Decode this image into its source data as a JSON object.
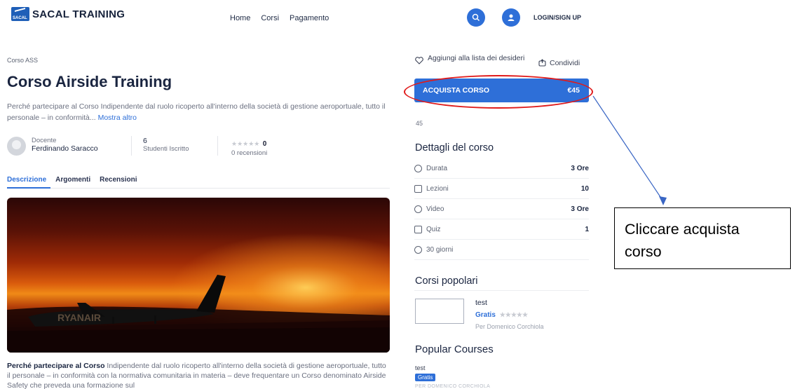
{
  "header": {
    "logo_text": "SACAL TRAINING",
    "logo_badge": "SACAL",
    "nav": [
      "Home",
      "Corsi",
      "Pagamento"
    ],
    "login": "LOGIN/SIGN UP",
    "search_icon": "search-icon",
    "user_icon": "user-icon"
  },
  "course": {
    "breadcrumb": "Corso ASS",
    "title": "Corso Airside Training",
    "intro": "Perché partecipare al Corso Indipendente dal ruolo ricoperto all'interno della società di gestione aeroportuale, tutto il personale – in conformità...",
    "more": "Mostra altro",
    "teacher_label": "Docente",
    "teacher_name": "Ferdinando Saracco",
    "students_count": "6",
    "students_label": "Studenti Iscritto",
    "rating_value": "0",
    "reviews_label": "0 recensioni",
    "tabs": [
      "Descrizione",
      "Argomenti",
      "Recensioni"
    ],
    "image_caption": "RYANAIR",
    "desc_bold": "Perché partecipare al Corso",
    "desc_text": " Indipendente dal ruolo ricoperto all'interno della società di gestione aeroportuale, tutto il personale – in conformità con la normativa comunitaria in materia – deve frequentare un Corso denominato Airside Safety che preveda una formazione sul"
  },
  "sidebar": {
    "wishlist": "Aggiungi alla lista dei desideri",
    "share": "Condividi",
    "buy_label": "ACQUISTA CORSO",
    "buy_price": "€45",
    "price_note": "45",
    "details_title": "Dettagli del corso",
    "details": [
      {
        "label": "Durata",
        "value": "3 Ore",
        "icon": "clock-icon"
      },
      {
        "label": "Lezioni",
        "value": "10",
        "icon": "book-icon"
      },
      {
        "label": "Video",
        "value": "3 Ore",
        "icon": "play-icon"
      },
      {
        "label": "Quiz",
        "value": "1",
        "icon": "quiz-icon"
      },
      {
        "label": "30 giorni",
        "value": "",
        "icon": "clock-icon"
      }
    ],
    "popular_title": "Corsi popolari",
    "popular_item_title": "test",
    "popular_item_price": "Gratis",
    "popular_item_by": "Per Domenico Corchiola",
    "popular_courses_title": "Popular Courses",
    "popular2_title": "test",
    "popular2_badge": "Gratis",
    "popular2_by": "PER DOMENICO CORCHIOLA"
  },
  "annotation": {
    "text": "Cliccare acquista corso",
    "ellipse_color": "#e01a1a",
    "arrow_color": "#3a66c4"
  }
}
